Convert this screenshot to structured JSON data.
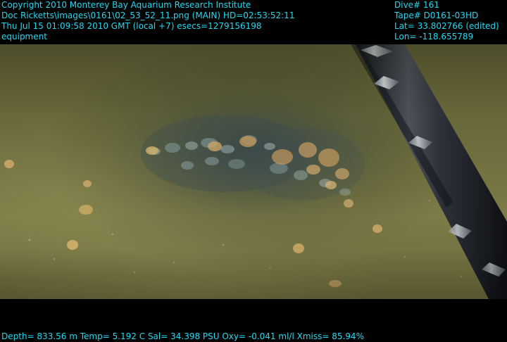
{
  "overlay": {
    "left_header": [
      "Copyright 2010 Monterey Bay Aquarium Research Institute",
      "Doc Ricketts\\images\\0161\\02_53_52_11.png (MAIN)  HD=02:53:52:11",
      "Thu Jul 15 01:09:58 2010 GMT (local +7)  esecs=1279156198",
      "equipment"
    ],
    "right_header": [
      "Dive# 161",
      "Tape# D0161-03HD",
      "Lat= 33.802766 (edited)",
      "Lon= -118.655789"
    ],
    "footer": "Depth= 833.56 m  Temp= 5.192 C  Sal= 34.398 PSU  Oxy= -0.041 ml/l  Xmiss= 85.94%"
  },
  "colors": {
    "overlay_text": "#27d7ee",
    "frame": "#000000",
    "sediment": "#6c6b3c",
    "rov_arm": "#2a2d34"
  },
  "image": {
    "subject": "seafloor-sediment-with-burrows",
    "equipment": "rov-manipulator-arm"
  }
}
